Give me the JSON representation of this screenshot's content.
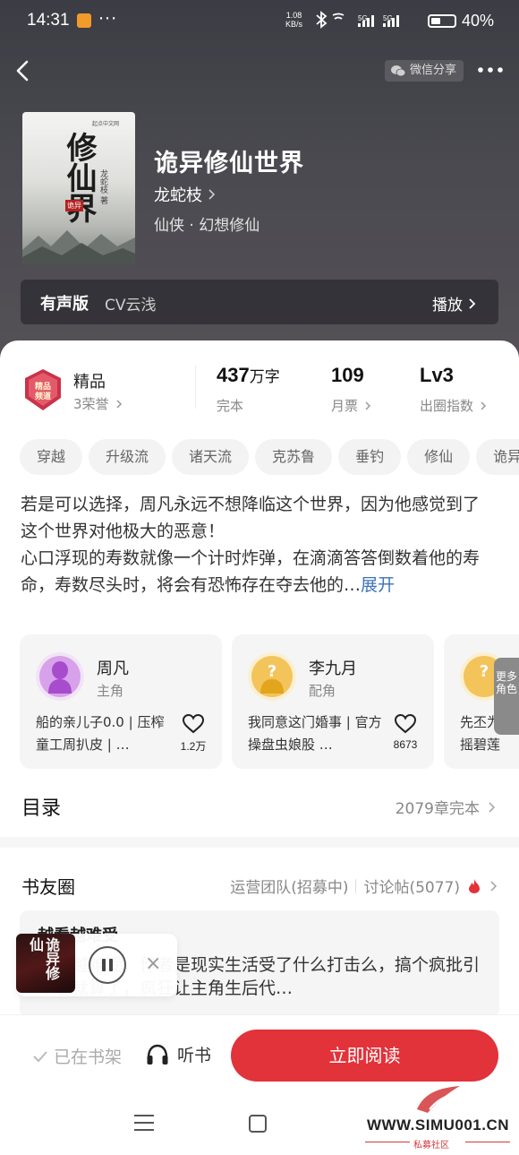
{
  "status_bar": {
    "time": "14:31",
    "dots": "···",
    "net_speed_value": "1.08",
    "net_speed_unit": "KB/s",
    "signal_1": "5G",
    "signal_2": "5G",
    "battery": "40%"
  },
  "header": {
    "share_label": "微信分享",
    "more_icon": "more-dots-icon"
  },
  "book": {
    "title": "诡异修仙世界",
    "author": "龙蛇枝",
    "genre": "仙侠 · 幻想修仙",
    "cover_title": "修仙世界",
    "cover_title_visible": "修仙界",
    "cover_author": "龙蛇枝 著",
    "cover_badge": "诡异",
    "cover_publisher": "起点中文网"
  },
  "audio": {
    "label": "有声版",
    "cv": "CV云浅",
    "play_label": "播放"
  },
  "stats": {
    "rank_label": "精品",
    "honors": "3荣誉",
    "words_num": "437",
    "words_unit": "万字",
    "words_status": "完本",
    "monthly_votes": "109",
    "monthly_votes_label": "月票",
    "level": "Lv3",
    "level_label": "出圈指数"
  },
  "tags": [
    "穿越",
    "升级流",
    "诸天流",
    "克苏鲁",
    "垂钓",
    "修仙",
    "诡异"
  ],
  "synopsis": {
    "text": "若是可以选择，周凡永远不想降临这个世界，因为他感觉到了这个世界对他极大的恶意！心口浮现的寿数就像一个计时炸弹，在滴滴答答倒数着他的寿命，寿数尽头时，将会有恐怖存在夺去他的…",
    "line1": "若是可以选择，周凡永远不想降临这个世界，因为他感觉到了这个世界对他极大的恶意！",
    "line2": "心口浮现的寿数就像一个计时炸弹，在滴滴答答倒数着他的寿命，寿数尽头时，将会有恐怖存在夺去他的…",
    "expand": "展开"
  },
  "roles": [
    {
      "name": "周凡",
      "type": "主角",
      "desc": "船的亲儿子0.0 | 压榨童工周扒皮 | …",
      "likes": "1.2万"
    },
    {
      "name": "李九月",
      "type": "配角",
      "desc": "我同意这门婚事 | 官方操盘虫娘股 …",
      "likes": "8673"
    },
    {
      "name": "",
      "type": "",
      "desc": "先丕为敬 | 不摇碧莲",
      "likes": ""
    }
  ],
  "more_roles": "更多角色",
  "toc": {
    "title": "目录",
    "info": "2079章完本"
  },
  "circle": {
    "title": "书友圈",
    "team": "运营团队(招募中)",
    "posts": "讨论帖(5077)"
  },
  "post": {
    "title": "越看越难受",
    "body": "越看越难受，作者是现实生活受了什么打击么，搞个疯批引导者就算了，疯狂让主角生后代…"
  },
  "mini_player": {
    "cover_text": "诡异修仙",
    "close": "×"
  },
  "actions": {
    "on_shelf": "已在书架",
    "listen": "听书",
    "read_now": "立即阅读"
  },
  "watermark": {
    "site": "WWW.SIMU001.CN",
    "sub": "私募社区"
  },
  "colors": {
    "accent": "#e2323a",
    "link": "#3e73b8",
    "hero_bg": "#45454b"
  }
}
